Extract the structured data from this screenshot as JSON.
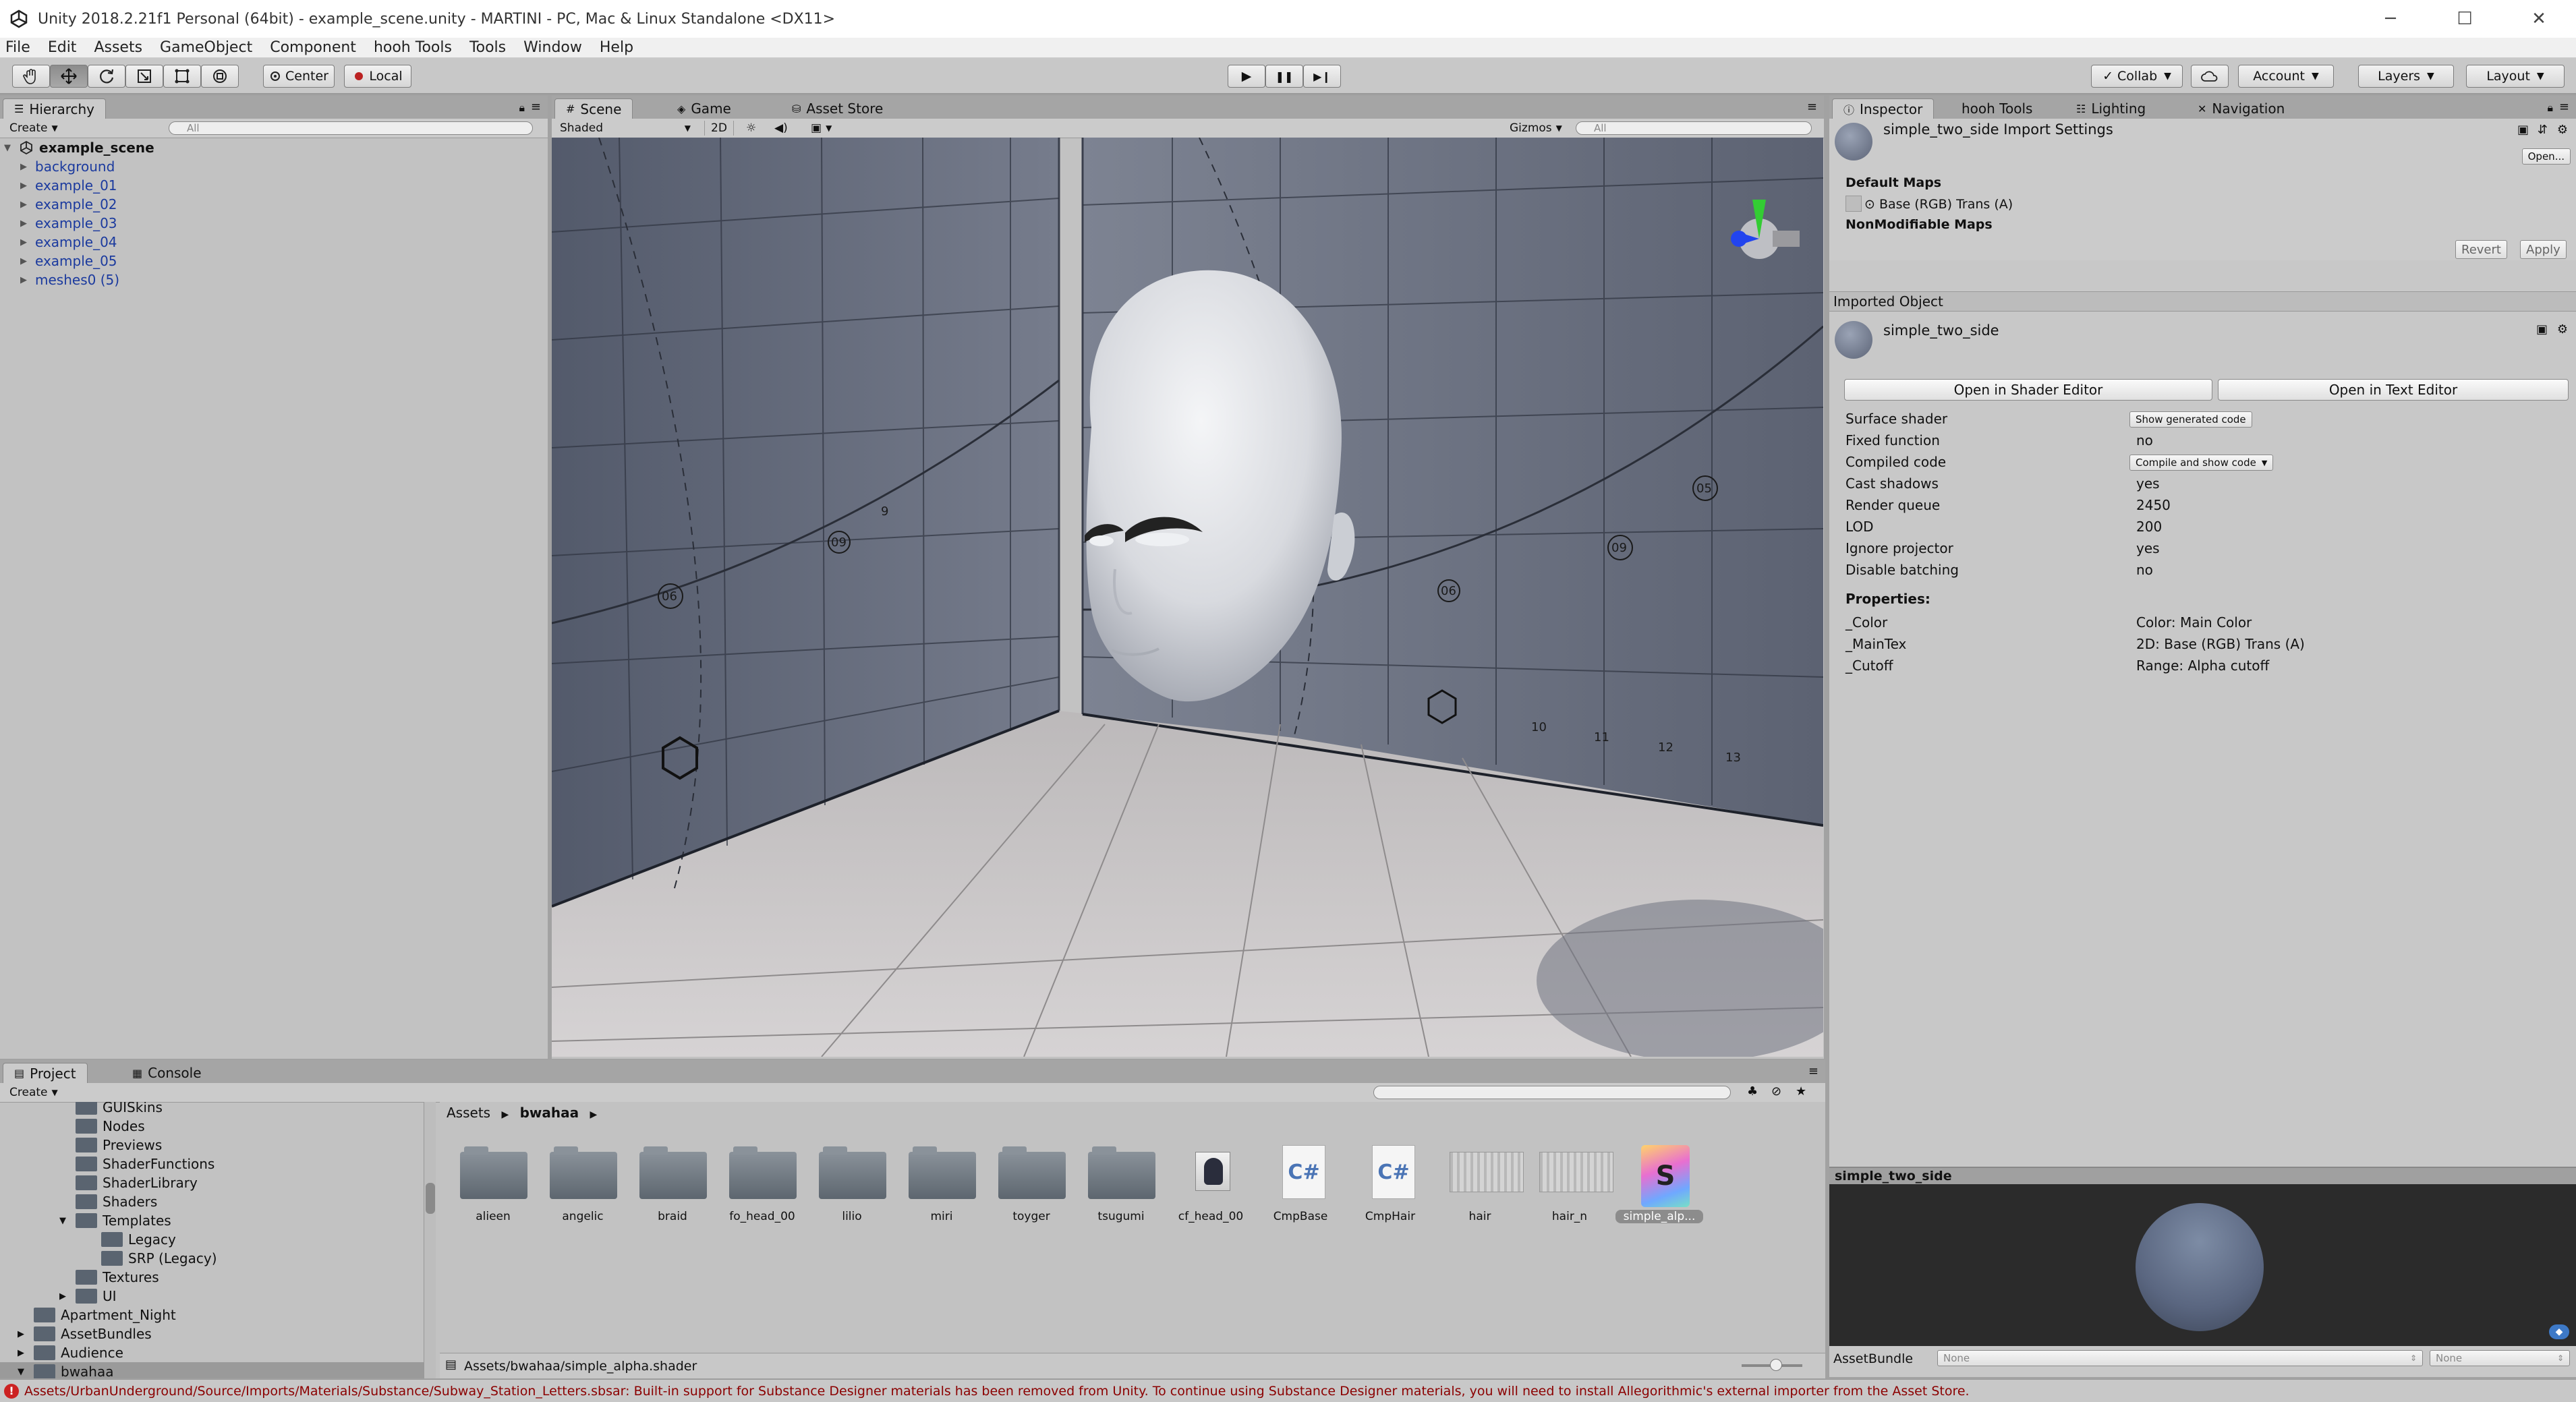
{
  "window": {
    "title": "Unity 2018.2.21f1 Personal (64bit) - example_scene.unity - MARTINI - PC, Mac & Linux Standalone <DX11>",
    "min_glyph": "─",
    "max_glyph": "☐",
    "close_glyph": "✕"
  },
  "menu": [
    "File",
    "Edit",
    "Assets",
    "GameObject",
    "Component",
    "hooh Tools",
    "Tools",
    "Window",
    "Help"
  ],
  "toolbar": {
    "pivot_label": "Center",
    "space_label": "Local",
    "collab_label": "Collab",
    "account_label": "Account",
    "layers_label": "Layers",
    "layout_label": "Layout",
    "play_glyph": "▶",
    "pause_glyph": "❚❚",
    "step_glyph": "▶❙"
  },
  "hierarchy": {
    "tab": "Hierarchy",
    "create": "Create",
    "search_placeholder": "All",
    "scene": "example_scene",
    "items": [
      "background",
      "example_01",
      "example_02",
      "example_03",
      "example_04",
      "example_05",
      "meshes0 (5)"
    ]
  },
  "scene_panel": {
    "tabs": [
      "Scene",
      "Game",
      "Asset Store"
    ],
    "shading": "Shaded",
    "mode_2d": "2D",
    "gizmos": "Gizmos",
    "search_placeholder": "All",
    "ruler_numbers": [
      "06",
      "09",
      "9",
      "06",
      "09",
      "05",
      "10",
      "11",
      "12",
      "13"
    ]
  },
  "inspector": {
    "tabs": [
      "Inspector",
      "hooh Tools",
      "Lighting",
      "Navigation"
    ],
    "import_title": "simple_two_side Import Settings",
    "open_button": "Open...",
    "default_maps_header": "Default Maps",
    "base_map": "Base (RGB) Trans (A)",
    "nonmodifiable_header": "NonModifiable Maps",
    "revert": "Revert",
    "apply": "Apply",
    "imported_object_header": "Imported Object",
    "object_name": "simple_two_side",
    "open_shader_editor": "Open in Shader Editor",
    "open_text_editor": "Open in Text Editor",
    "rows": [
      {
        "label": "Surface shader",
        "value": "Show generated code"
      },
      {
        "label": "Fixed function",
        "value": "no"
      },
      {
        "label": "Compiled code",
        "value": "Compile and show code"
      },
      {
        "label": "Cast shadows",
        "value": "yes"
      },
      {
        "label": "Render queue",
        "value": "2450"
      },
      {
        "label": "LOD",
        "value": "200"
      },
      {
        "label": "Ignore projector",
        "value": "yes"
      },
      {
        "label": "Disable batching",
        "value": "no"
      }
    ],
    "properties_header": "Properties:",
    "properties": [
      {
        "name": "_Color",
        "desc": "Color: Main Color"
      },
      {
        "name": "_MainTex",
        "desc": "2D: Base (RGB) Trans (A)"
      },
      {
        "name": "_Cutoff",
        "desc": "Range: Alpha cutoff"
      }
    ],
    "preview_title": "simple_two_side",
    "assetbundle_label": "AssetBundle",
    "assetbundle_value": "None",
    "assetbundle_variant": "None"
  },
  "project": {
    "tabs": [
      "Project",
      "Console"
    ],
    "create": "Create",
    "tree": [
      {
        "label": "GUISkins",
        "indent": 3,
        "arrow": ""
      },
      {
        "label": "Nodes",
        "indent": 3,
        "arrow": ""
      },
      {
        "label": "Previews",
        "indent": 3,
        "arrow": ""
      },
      {
        "label": "ShaderFunctions",
        "indent": 3,
        "arrow": ""
      },
      {
        "label": "ShaderLibrary",
        "indent": 3,
        "arrow": ""
      },
      {
        "label": "Shaders",
        "indent": 3,
        "arrow": ""
      },
      {
        "label": "Templates",
        "indent": 3,
        "arrow": "▼"
      },
      {
        "label": "Legacy",
        "indent": 4,
        "arrow": ""
      },
      {
        "label": "SRP (Legacy)",
        "indent": 4,
        "arrow": ""
      },
      {
        "label": "Textures",
        "indent": 3,
        "arrow": ""
      },
      {
        "label": "UI",
        "indent": 3,
        "arrow": "▶"
      },
      {
        "label": "Apartment_Night",
        "indent": 1,
        "arrow": ""
      },
      {
        "label": "AssetBundles",
        "indent": 1,
        "arrow": "▶"
      },
      {
        "label": "Audience",
        "indent": 1,
        "arrow": "▶"
      },
      {
        "label": "bwahaa",
        "indent": 1,
        "arrow": "▼"
      }
    ],
    "breadcrumb_root": "Assets",
    "breadcrumb_current": "bwahaa",
    "assets": [
      {
        "name": "alieen",
        "kind": "folder"
      },
      {
        "name": "angelic",
        "kind": "folder"
      },
      {
        "name": "braid",
        "kind": "folder"
      },
      {
        "name": "fo_head_00",
        "kind": "folder"
      },
      {
        "name": "lilio",
        "kind": "folder"
      },
      {
        "name": "miri",
        "kind": "folder"
      },
      {
        "name": "toyger",
        "kind": "folder"
      },
      {
        "name": "tsugumi",
        "kind": "folder"
      },
      {
        "name": "cf_head_00",
        "kind": "image"
      },
      {
        "name": "CmpBase",
        "kind": "cs"
      },
      {
        "name": "CmpHair",
        "kind": "cs"
      },
      {
        "name": "hair",
        "kind": "texture"
      },
      {
        "name": "hair_n",
        "kind": "texture"
      },
      {
        "name": "simple_alp...",
        "kind": "shader"
      }
    ],
    "cs_label": "C#",
    "shader_label": "S",
    "selected_path": "Assets/bwahaa/simple_alpha.shader"
  },
  "status": {
    "message": "Assets/UrbanUnderground/Source/Imports/Materials/Substance/Subway_Station_Letters.sbsar: Built-in support for Substance Designer materials has been removed from Unity. To continue using Substance Designer materials, you will need to install Allegorithmic's external importer from the Asset Store."
  },
  "colors": {
    "status_error": "#8b0000",
    "hierarchy_blue": "#1b3a9e",
    "panel_bg": "#c2c2c2",
    "tab_bar": "#a5a5a5",
    "scene_floor": "#c9c6c7",
    "scene_wall": "#5f6473"
  }
}
